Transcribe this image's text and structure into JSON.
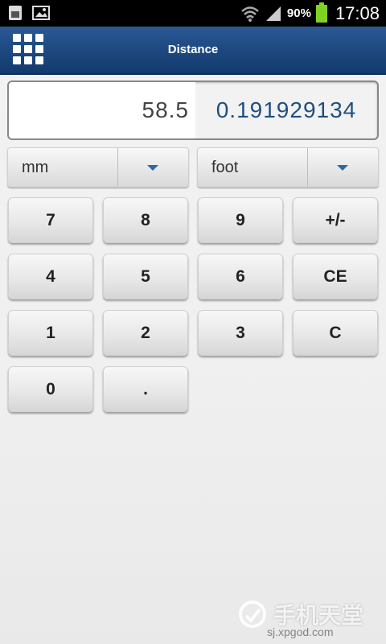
{
  "status_bar": {
    "battery_percent": "90%",
    "time": "17:08",
    "icons": [
      "sim-card-icon",
      "image-icon",
      "wifi-icon",
      "signal-icon",
      "battery-icon"
    ]
  },
  "app_bar": {
    "title": "Distance",
    "menu_icon": "grid-menu-icon"
  },
  "display": {
    "input_value": "58.5",
    "output_value": "0.191929134"
  },
  "units": {
    "from": "mm",
    "to": "foot"
  },
  "keypad": {
    "k7": "7",
    "k8": "8",
    "k9": "9",
    "sign": "+/-",
    "k4": "4",
    "k5": "5",
    "k6": "6",
    "ce": "CE",
    "k1": "1",
    "k2": "2",
    "k3": "3",
    "c": "C",
    "k0": "0",
    "dot": "."
  },
  "watermark": {
    "title": "手机天堂",
    "url": "sj.xpgod.com"
  },
  "colors": {
    "appbar": "#1f4a82",
    "output_text": "#1f4f7f",
    "dropdown_arrow": "#2d6aa5",
    "battery": "#7ed321"
  }
}
